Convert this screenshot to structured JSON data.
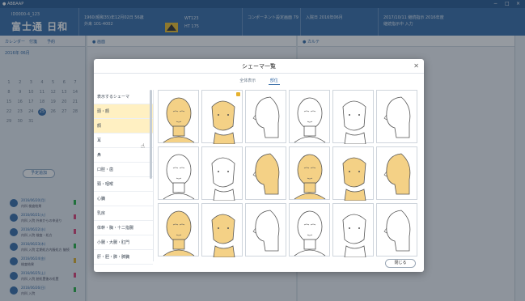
{
  "titlebar": {
    "title": "● ABBAAP",
    "minimize": "−",
    "maximize": "□",
    "close": "×"
  },
  "header": {
    "patient_id": "ID0000-4_123",
    "patient_name": "富士通 日和",
    "info_lines": [
      "1960(昭和35)年12月02日 56歳",
      "外来    101-4002",
      "WT123",
      "HT 175",
      "コンポーネント設定画面 79",
      "入院日 2016年06月",
      "2017/10/11 継続指示 2016年度",
      "継続指示中 入力"
    ]
  },
  "left": {
    "tabs": [
      "カレンダー",
      "付箋",
      "予約"
    ],
    "month": "2016年 06月",
    "calendar": [
      [
        "",
        "",
        "",
        "",
        "",
        "",
        ""
      ],
      [
        "1",
        "2",
        "3",
        "4",
        "5",
        "6",
        "7"
      ],
      [
        "8",
        "9",
        "10",
        "11",
        "12",
        "13",
        "14"
      ],
      [
        "15",
        "16",
        "17",
        "18",
        "19",
        "20",
        "21"
      ],
      [
        "22",
        "23",
        "24",
        "25",
        "26",
        "27",
        "28"
      ],
      [
        "29",
        "30",
        "31",
        "",
        "",
        "",
        ""
      ]
    ],
    "selected_day": "25",
    "preset_button": "予定追加",
    "items": [
      {
        "date": "2016/06/20(月)",
        "text": "内科 検査結果",
        "flag": "#2db34a"
      },
      {
        "date": "2016/06/21(火)",
        "text": "内科 入院 外来からの申送り",
        "flag": "#e0457b"
      },
      {
        "date": "2016/06/22(水)",
        "text": "内科 入院 検査・処方",
        "flag": "#e0457b"
      },
      {
        "date": "2016/06/23(木)",
        "text": "内科 入院 定期処方内服処方 継続",
        "flag": "#2db34a"
      },
      {
        "date": "2016/06/24(金)",
        "text": "検査結果",
        "flag": "#e0b12e"
      },
      {
        "date": "2016/06/25(土)",
        "text": "内科 入院 創処置後の処置",
        "flag": "#e0457b"
      },
      {
        "date": "2016/06/26(日)",
        "text": "内科 入院",
        "flag": "#2db34a"
      }
    ]
  },
  "mid": {
    "header": "● 画面"
  },
  "right": {
    "header": "● カルテ"
  },
  "modal": {
    "title": "シェーマ一覧",
    "tabs": [
      "全体表示",
      "部位"
    ],
    "active_tab": "部位",
    "categories": [
      "表示するシェーマ",
      "頭・顔",
      "顔",
      "耳",
      "鼻",
      "口腔・歯",
      "頸・咽喉",
      "心臓",
      "乳房",
      "体幹・胸・十二指腸",
      "小腸・大腸・肛門",
      "肝・胆・膵・脾臓"
    ],
    "highlighted": [
      "頭・顔",
      "顔"
    ],
    "close_button": "閉じる",
    "tiles": [
      {
        "name": "head-front-yellow",
        "fill": "#f4d186",
        "star": false
      },
      {
        "name": "head-front-yellow-2",
        "fill": "#f4d186",
        "star": true
      },
      {
        "name": "head-lymph-diagram",
        "fill": "#ffffff",
        "star": false
      },
      {
        "name": "head-front-bald",
        "fill": "#ffffff",
        "star": false
      },
      {
        "name": "neck-outline",
        "fill": "#ffffff",
        "star": false
      },
      {
        "name": "face-outline",
        "fill": "#ffffff",
        "star": false
      },
      {
        "name": "head-outline-hair",
        "fill": "#ffffff",
        "star": false
      },
      {
        "name": "child-head-outline",
        "fill": "#ffffff",
        "star": false
      },
      {
        "name": "chin-up-yellow",
        "fill": "#f4d186",
        "star": false
      },
      {
        "name": "chin-up-yellow-2",
        "fill": "#f4d186",
        "star": false
      },
      {
        "name": "head-side-yellow",
        "fill": "#f4d186",
        "star": false
      },
      {
        "name": "head-side-yellow-2",
        "fill": "#f4d186",
        "star": false
      },
      {
        "name": "head-profile-yellow",
        "fill": "#f4d186",
        "star": false
      },
      {
        "name": "head-profile-yellow-2",
        "fill": "#f4d186",
        "star": false
      },
      {
        "name": "skull-nerves-diagram",
        "fill": "#ffffff",
        "star": false
      },
      {
        "name": "neck-side-outline",
        "fill": "#ffffff",
        "star": false
      },
      {
        "name": "neck-side-outline-2",
        "fill": "#ffffff",
        "star": false
      },
      {
        "name": "neck-side-outline-3",
        "fill": "#ffffff",
        "star": false
      }
    ]
  }
}
